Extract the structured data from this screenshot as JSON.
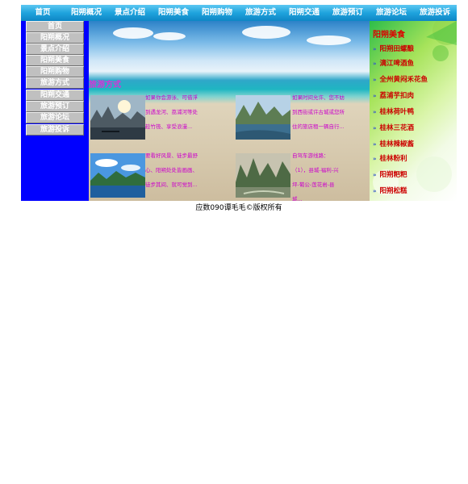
{
  "topnav": [
    "首页",
    "阳朔概况",
    "景点介绍",
    "阳朔美食",
    "阳朔购物",
    "旅游方式",
    "阳朔交通",
    "旅游预订",
    "旅游论坛",
    "旅游投诉"
  ],
  "sidebar": [
    "首页",
    "阳朔概况",
    "景点介绍",
    "阳朔美食",
    "阳朔购物",
    "旅游方式",
    "阳朔交通",
    "旅游预订",
    "旅游论坛",
    "旅游投诉"
  ],
  "main": {
    "section_title": "旅游方式",
    "cards": [
      {
        "lines": [
          "如果你会游泳、可借浮",
          "到遇龙河、荔浦河等处",
          "趁竹筏、享受浪漫..."
        ]
      },
      {
        "lines": [
          "如果时间允许、您不妨",
          "到西街或许古城或您所",
          "住的旅店租一辆自行..."
        ]
      },
      {
        "lines": [
          "要看好风景、徒步最舒",
          "心、阳朔处处皆画画、",
          "徒步其间、就可觉到..."
        ]
      },
      {
        "lines": [
          "自驾车游线路：",
          "（1），县城-福利-兴",
          "坪-葡公-莲花岩-县",
          "城..."
        ]
      }
    ]
  },
  "rightpanel": {
    "title": "阳朔美食",
    "items": [
      "阳朔田螺酿",
      "漓江啤酒鱼",
      "全州黄闷禾花鱼",
      "荔浦芋扣肉",
      "桂林荷叶鸭",
      "桂林三花酒",
      "桂林辣椒酱",
      "桂林粉利",
      "阳朔粑粑",
      "阳朔松糕"
    ]
  },
  "footer": "应数090谭毛毛©版权所有",
  "colors": {
    "nav": "#1fa3dd",
    "sidebar_bg": "#0000ff",
    "sidebar_item": "#c0c0c0",
    "card_text": "#cc00cc",
    "food_text": "#cc0000"
  }
}
